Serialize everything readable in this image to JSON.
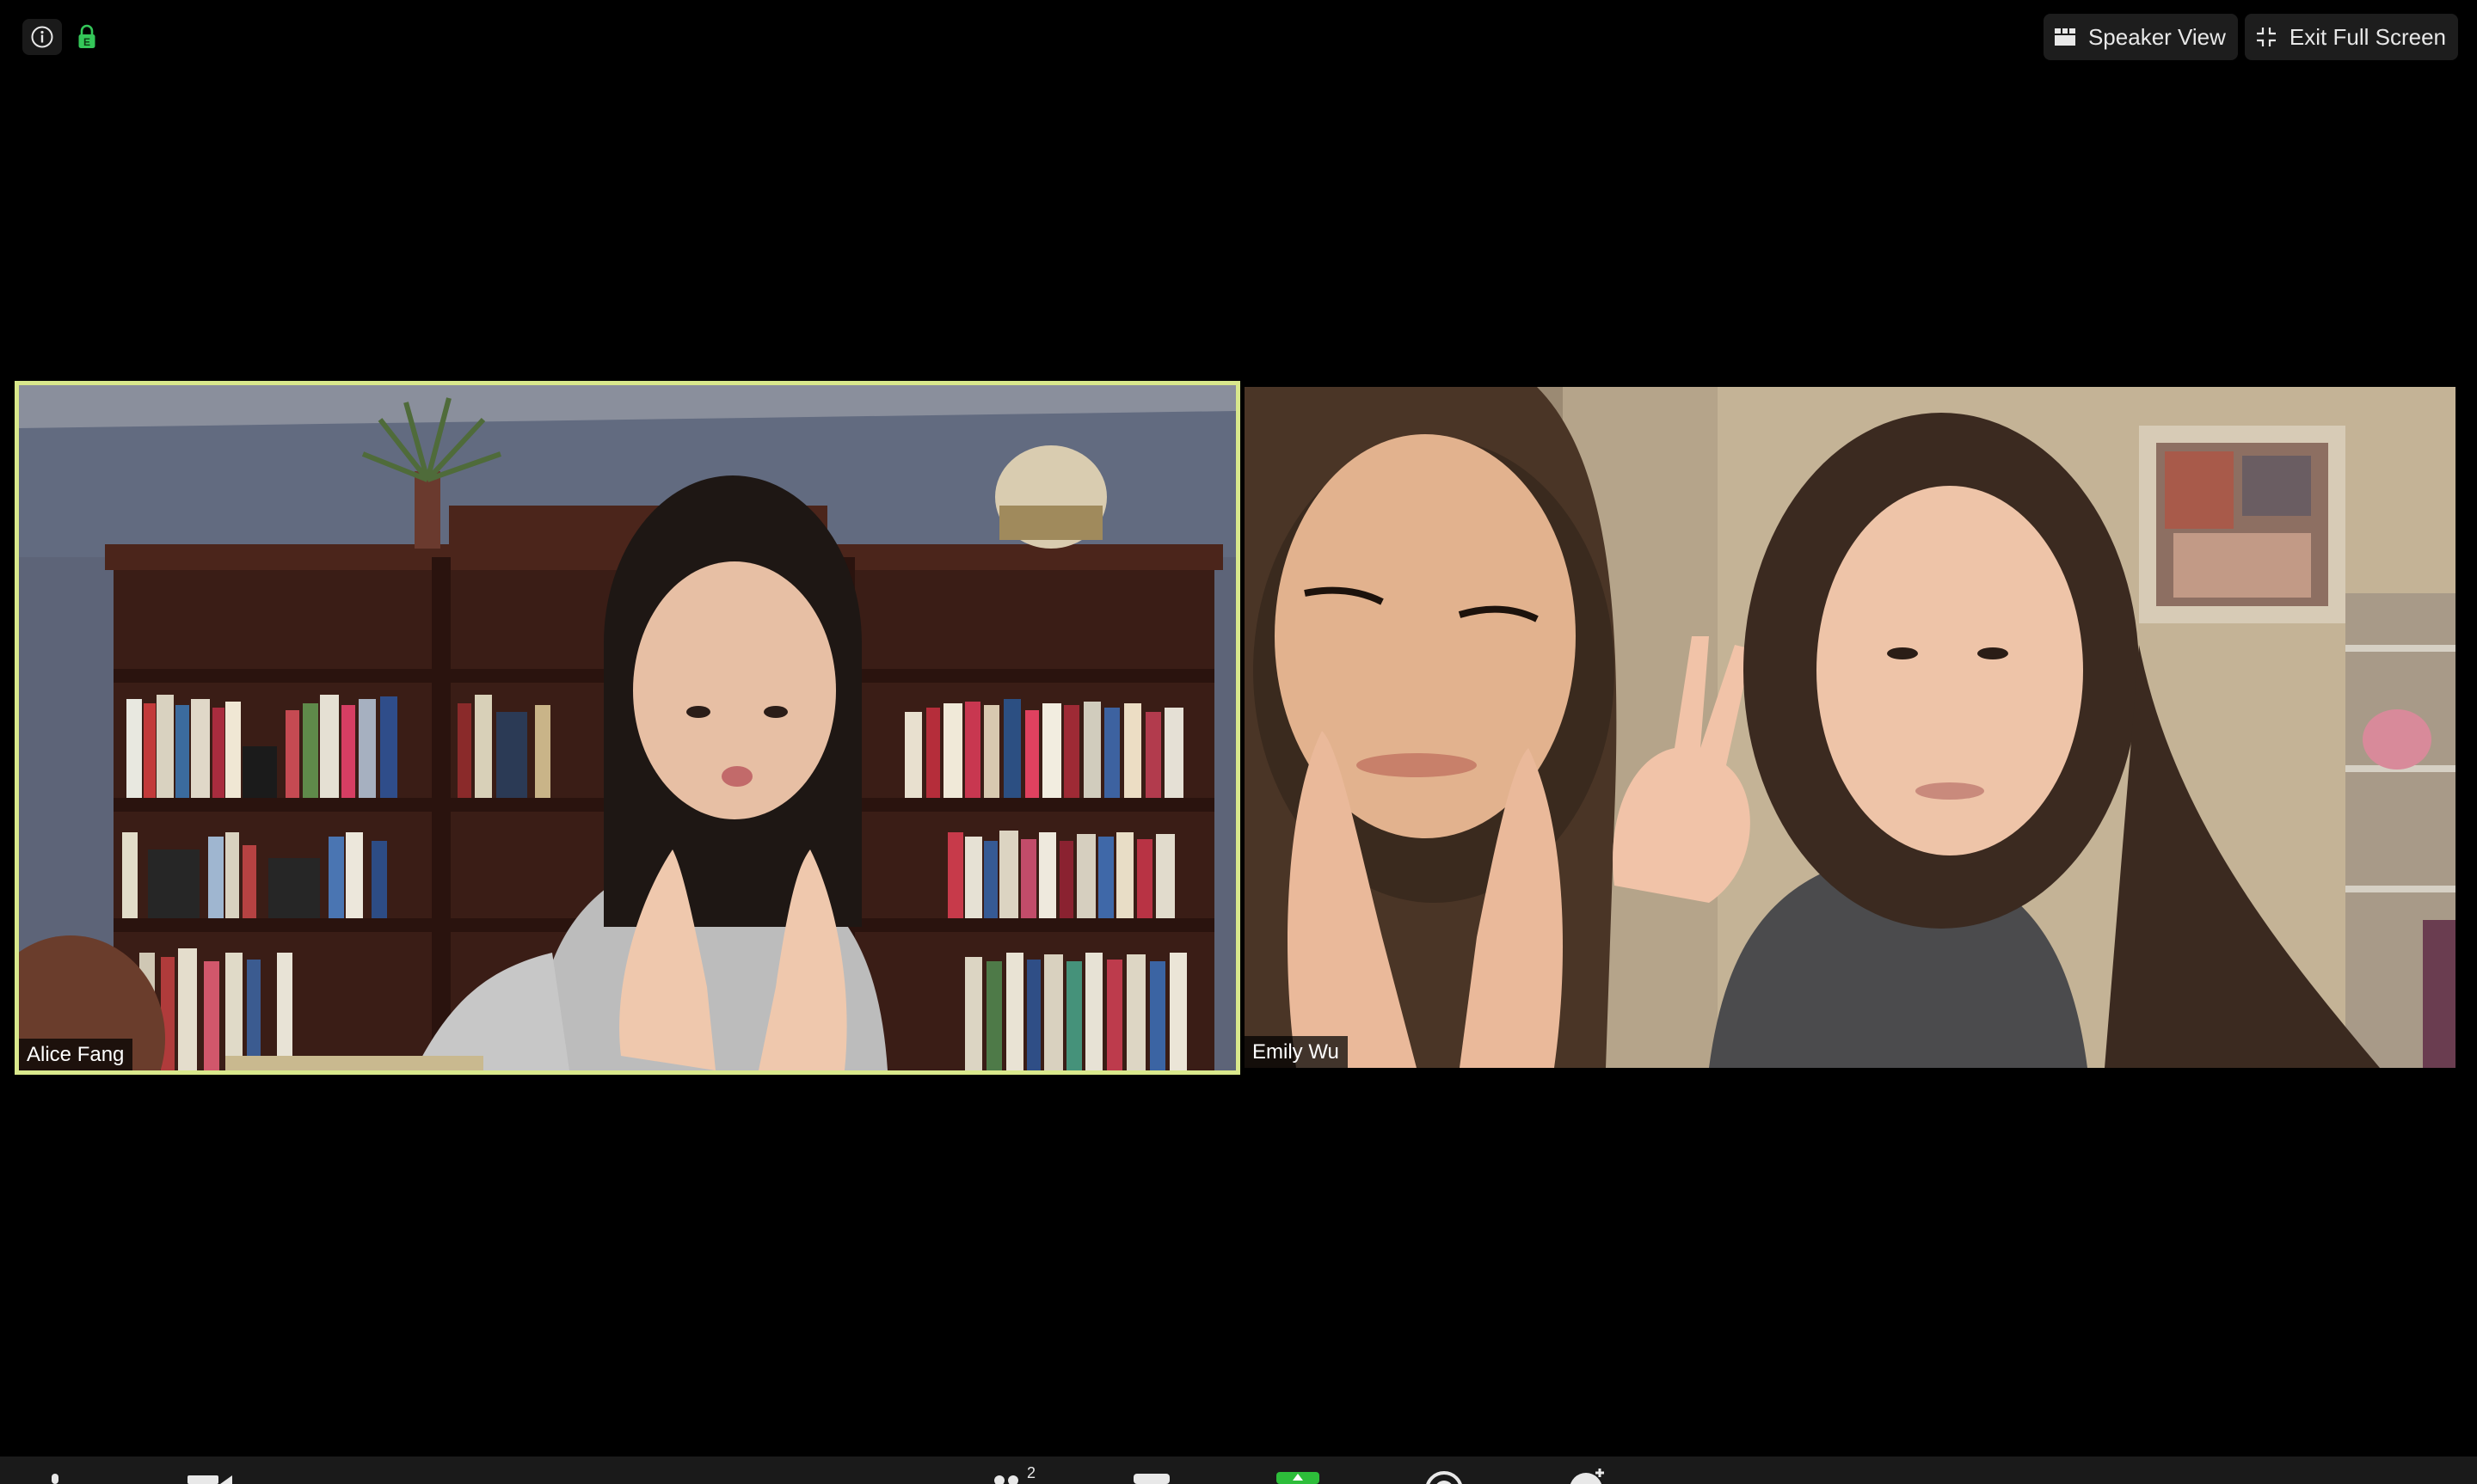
{
  "window": {
    "info_icon": "info-icon",
    "lock_icon": "lock-icon"
  },
  "controls": {
    "speaker_view_label": "Speaker View",
    "exit_full_screen_label": "Exit Full Screen"
  },
  "participants": [
    {
      "name": "Alice Fang",
      "active_speaker": true
    },
    {
      "name": "Emily Wu",
      "active_speaker": false
    }
  ],
  "toolbar": {
    "items": [
      {
        "name": "mute",
        "icon": "microphone-icon"
      },
      {
        "name": "video",
        "icon": "camera-icon"
      },
      {
        "name": "participants",
        "icon": "participants-icon",
        "count": "2"
      },
      {
        "name": "chat",
        "icon": "chat-icon"
      },
      {
        "name": "share",
        "icon": "share-screen-icon"
      },
      {
        "name": "record",
        "icon": "record-icon"
      },
      {
        "name": "reactions",
        "icon": "reactions-icon"
      }
    ]
  },
  "colors": {
    "active_border": "#d9e88c",
    "lock_green": "#34c759",
    "share_green": "#2dbd3a",
    "background": "#000000"
  }
}
